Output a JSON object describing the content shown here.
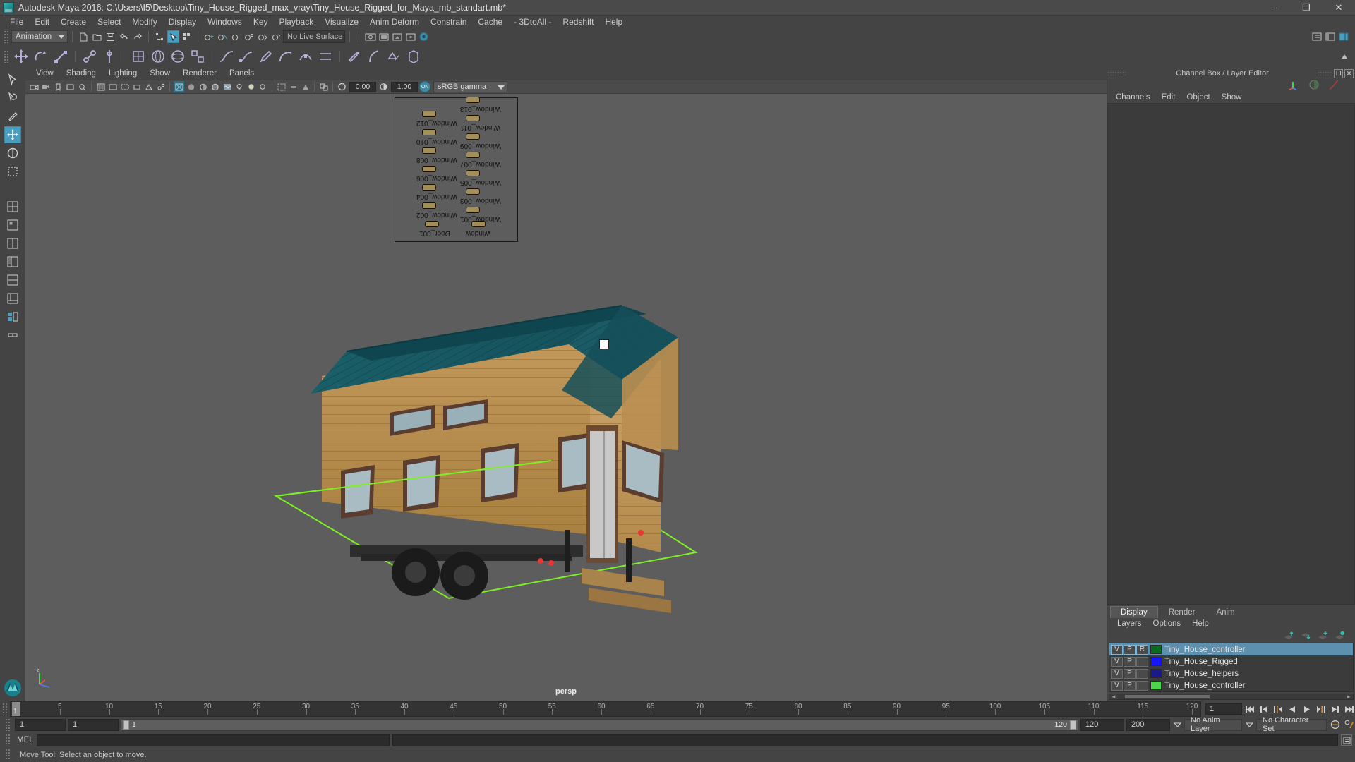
{
  "window": {
    "title": "Autodesk Maya 2016: C:\\Users\\I5\\Desktop\\Tiny_House_Rigged_max_vray\\Tiny_House_Rigged_for_Maya_mb_standart.mb*",
    "minimize": "–",
    "maximize": "❐",
    "close": "✕"
  },
  "menubar": {
    "items": [
      {
        "label": "File"
      },
      {
        "label": "Edit"
      },
      {
        "label": "Create"
      },
      {
        "label": "Select"
      },
      {
        "label": "Modify"
      },
      {
        "label": "Display"
      },
      {
        "label": "Windows"
      },
      {
        "label": "Key"
      },
      {
        "label": "Playback"
      },
      {
        "label": "Visualize"
      },
      {
        "label": "Anim Deform"
      },
      {
        "label": "Constrain"
      },
      {
        "label": "Cache"
      },
      {
        "label": "- 3DtoAll -"
      },
      {
        "label": "Redshift"
      },
      {
        "label": "Help"
      }
    ]
  },
  "toolbar": {
    "mode": "Animation",
    "live_surface": "No Live Surface"
  },
  "viewport_menu": {
    "items": [
      {
        "label": "View"
      },
      {
        "label": "Shading"
      },
      {
        "label": "Lighting"
      },
      {
        "label": "Show"
      },
      {
        "label": "Renderer"
      },
      {
        "label": "Panels"
      }
    ]
  },
  "viewport_toolbar": {
    "exposure": "0.00",
    "gamma": "1.00",
    "on_badge": "ON",
    "color_profile": "sRGB gamma"
  },
  "viewport": {
    "camera_label": "persp",
    "axis_labels": {
      "x": "x",
      "y": "y",
      "z": "z"
    },
    "outliner_overlay": {
      "items": [
        "Window_013",
        "Window_012",
        "Window_011",
        "Window_010",
        "Window_009",
        "Window_008",
        "Window_007",
        "Window_006",
        "Window_005",
        "Window_004",
        "Window_003",
        "Window_002",
        "Window_001",
        "Door_001",
        "Window"
      ]
    }
  },
  "channel_box": {
    "title": "Channel Box / Layer Editor",
    "restore_btn": "❐",
    "close_btn": "✕",
    "menu": [
      {
        "label": "Channels"
      },
      {
        "label": "Edit"
      },
      {
        "label": "Object"
      },
      {
        "label": "Show"
      }
    ]
  },
  "layer_editor": {
    "tabs": [
      {
        "label": "Display",
        "active": true
      },
      {
        "label": "Render",
        "active": false
      },
      {
        "label": "Anim",
        "active": false
      }
    ],
    "menu": [
      {
        "label": "Layers"
      },
      {
        "label": "Options"
      },
      {
        "label": "Help"
      }
    ],
    "columns": [
      "V",
      "P",
      "R"
    ],
    "layers": [
      {
        "v": "V",
        "p": "P",
        "r": "R",
        "color": "#0a6b1e",
        "name": "Tiny_House_controller",
        "selected": true
      },
      {
        "v": "V",
        "p": "P",
        "r": "",
        "color": "#1515ff",
        "name": "Tiny_House_Rigged",
        "selected": false
      },
      {
        "v": "V",
        "p": "P",
        "r": "",
        "color": "#1a1a8c",
        "name": "Tiny_House_helpers",
        "selected": false
      },
      {
        "v": "V",
        "p": "P",
        "r": "",
        "color": "#4fd44f",
        "name": "Tiny_House_controller",
        "selected": false
      }
    ]
  },
  "timeline": {
    "ticks": [
      5,
      10,
      15,
      20,
      25,
      30,
      35,
      40,
      45,
      50,
      55,
      60,
      65,
      70,
      75,
      80,
      85,
      90,
      95,
      100,
      105,
      110,
      115,
      120
    ],
    "start": 1,
    "end": 120,
    "current_frame": "1",
    "current_frame_label": "1"
  },
  "range": {
    "anim_start": "1",
    "playback_start": "1",
    "slider_start_label": "1",
    "slider_end_label": "120",
    "playback_end": "120",
    "anim_end": "200",
    "anim_layer": "No Anim Layer",
    "character_set": "No Character Set"
  },
  "mel": {
    "label": "MEL",
    "command": "",
    "output": ""
  },
  "status": {
    "message": "Move Tool: Select an object to move."
  },
  "colors": {
    "accent": "#4a9fc0",
    "panel_bg": "#444444",
    "viewport_bg": "#5d5d5d",
    "roof": "#16565f",
    "wall": "#b68b4f",
    "ground_line": "#77ee22",
    "timeline_bg": "#333333"
  }
}
